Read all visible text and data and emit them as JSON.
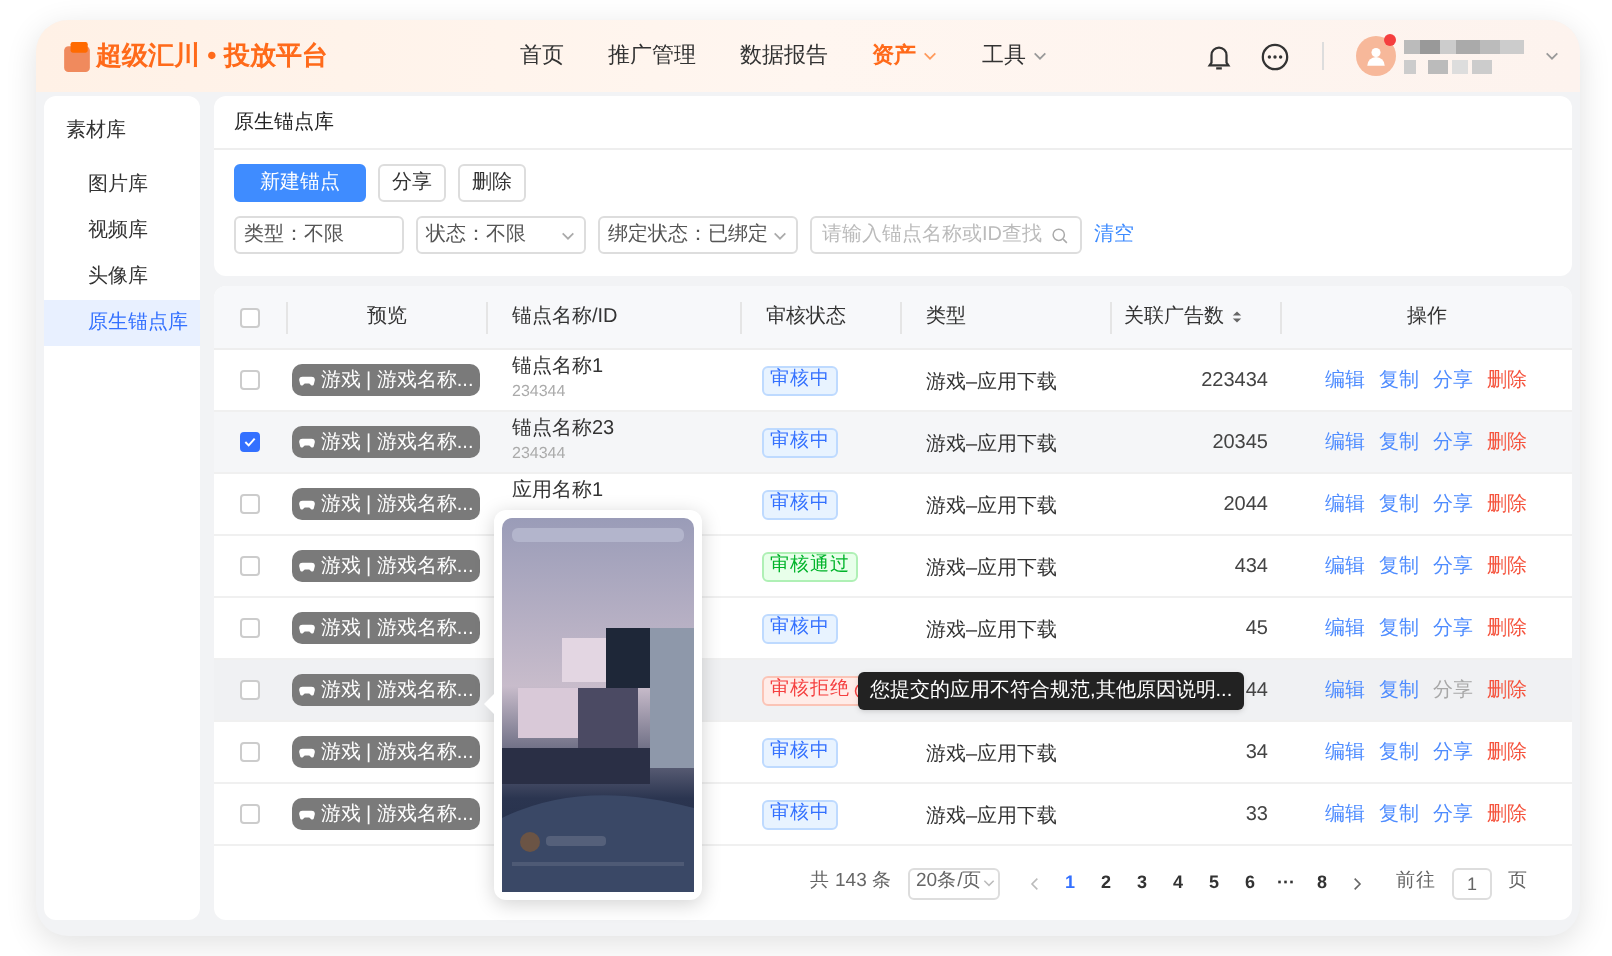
{
  "header": {
    "logo": "超级汇川 • 投放平台",
    "nav": [
      {
        "label": "首页",
        "selected": false,
        "dropdown": false
      },
      {
        "label": "推广管理",
        "selected": false,
        "dropdown": false
      },
      {
        "label": "数据报告",
        "selected": false,
        "dropdown": false
      },
      {
        "label": "资产",
        "selected": true,
        "dropdown": true
      },
      {
        "label": "工具",
        "selected": false,
        "dropdown": true
      }
    ],
    "notification_dot": true
  },
  "sidebar": {
    "title": "素材库",
    "items": [
      {
        "label": "图片库",
        "selected": false
      },
      {
        "label": "视频库",
        "selected": false
      },
      {
        "label": "头像库",
        "selected": false
      },
      {
        "label": "原生锚点库",
        "selected": true
      }
    ]
  },
  "page_title": "原生锚点库",
  "buttons": [
    {
      "label": "新建锚点",
      "kind": "primary"
    },
    {
      "label": "分享",
      "kind": "default"
    },
    {
      "label": "删除",
      "kind": "default"
    }
  ],
  "filters": [
    {
      "label": "类型：不限",
      "dropdown": false
    },
    {
      "label": "状态：不限",
      "dropdown": true
    },
    {
      "label": "绑定状态：已绑定",
      "dropdown": true
    }
  ],
  "search": {
    "placeholder": "请输入锚点名称或ID查找"
  },
  "clear_link": "清空",
  "table": {
    "all_selected": false,
    "columns": [
      {
        "label": "预览",
        "sortable": false
      },
      {
        "label": "锚点名称/ID",
        "sortable": false
      },
      {
        "label": "审核状态",
        "sortable": false
      },
      {
        "label": "类型",
        "sortable": false
      },
      {
        "label": "关联广告数",
        "sortable": true
      },
      {
        "label": "操作",
        "sortable": false
      }
    ],
    "rows": [
      {
        "selected": false,
        "hovered": false,
        "preview": "游戏 | 游戏名称...",
        "name": "锚点名称1",
        "id": "234344",
        "status": {
          "label": "审核中",
          "kind": "reviewing"
        },
        "type": "游戏–应用下载",
        "ad_count": "223434",
        "actions": [
          {
            "label": "编辑",
            "kind": "link",
            "disabled": false
          },
          {
            "label": "复制",
            "kind": "link",
            "disabled": false
          },
          {
            "label": "分享",
            "kind": "link",
            "disabled": false
          },
          {
            "label": "删除",
            "kind": "danger",
            "disabled": false
          }
        ]
      },
      {
        "selected": true,
        "hovered": false,
        "preview": "游戏 | 游戏名称...",
        "name": "锚点名称23",
        "id": "234344",
        "status": {
          "label": "审核中",
          "kind": "reviewing"
        },
        "type": "游戏–应用下载",
        "ad_count": "20345",
        "actions": [
          {
            "label": "编辑",
            "kind": "link",
            "disabled": false
          },
          {
            "label": "复制",
            "kind": "link",
            "disabled": false
          },
          {
            "label": "分享",
            "kind": "link",
            "disabled": false
          },
          {
            "label": "删除",
            "kind": "danger",
            "disabled": false
          }
        ]
      },
      {
        "selected": false,
        "hovered": false,
        "preview": "游戏 | 游戏名称...",
        "name": "应用名称1",
        "status": {
          "label": "审核中",
          "kind": "reviewing"
        },
        "type": "游戏–应用下载",
        "ad_count": "2044",
        "actions": [
          {
            "label": "编辑",
            "kind": "link",
            "disabled": false
          },
          {
            "label": "复制",
            "kind": "link",
            "disabled": false
          },
          {
            "label": "分享",
            "kind": "link",
            "disabled": false
          },
          {
            "label": "删除",
            "kind": "danger",
            "disabled": false
          }
        ]
      },
      {
        "selected": false,
        "hovered": false,
        "preview": "游戏 | 游戏名称...",
        "status": {
          "label": "审核通过",
          "kind": "approved"
        },
        "type": "游戏–应用下载",
        "ad_count": "434",
        "actions": [
          {
            "label": "编辑",
            "kind": "link",
            "disabled": false
          },
          {
            "label": "复制",
            "kind": "link",
            "disabled": false
          },
          {
            "label": "分享",
            "kind": "link",
            "disabled": false
          },
          {
            "label": "删除",
            "kind": "danger",
            "disabled": false
          }
        ]
      },
      {
        "selected": false,
        "hovered": false,
        "preview": "游戏 | 游戏名称...",
        "status": {
          "label": "审核中",
          "kind": "reviewing"
        },
        "type": "游戏–应用下载",
        "ad_count": "45",
        "actions": [
          {
            "label": "编辑",
            "kind": "link",
            "disabled": false
          },
          {
            "label": "复制",
            "kind": "link",
            "disabled": false
          },
          {
            "label": "分享",
            "kind": "link",
            "disabled": false
          },
          {
            "label": "删除",
            "kind": "danger",
            "disabled": false
          }
        ]
      },
      {
        "selected": false,
        "hovered": true,
        "preview": "游戏 | 游戏名称...",
        "status": {
          "label": "审核拒绝",
          "kind": "rejected"
        },
        "ad_count": "44",
        "tooltip": "您提交的应用不符合规范,其他原因说明...",
        "actions": [
          {
            "label": "编辑",
            "kind": "link",
            "disabled": false
          },
          {
            "label": "复制",
            "kind": "link",
            "disabled": false
          },
          {
            "label": "分享",
            "kind": "link",
            "disabled": true
          },
          {
            "label": "删除",
            "kind": "danger",
            "disabled": false
          }
        ]
      },
      {
        "selected": false,
        "hovered": false,
        "preview": "游戏 | 游戏名称...",
        "status": {
          "label": "审核中",
          "kind": "reviewing"
        },
        "type": "游戏–应用下载",
        "ad_count": "34",
        "actions": [
          {
            "label": "编辑",
            "kind": "link",
            "disabled": false
          },
          {
            "label": "复制",
            "kind": "link",
            "disabled": false
          },
          {
            "label": "分享",
            "kind": "link",
            "disabled": false
          },
          {
            "label": "删除",
            "kind": "danger",
            "disabled": false
          }
        ]
      },
      {
        "selected": false,
        "hovered": false,
        "preview": "游戏 | 游戏名称...",
        "status": {
          "label": "审核中",
          "kind": "reviewing"
        },
        "type": "游戏–应用下载",
        "ad_count": "33",
        "actions": [
          {
            "label": "编辑",
            "kind": "link",
            "disabled": false
          },
          {
            "label": "复制",
            "kind": "link",
            "disabled": false
          },
          {
            "label": "分享",
            "kind": "link",
            "disabled": false
          },
          {
            "label": "删除",
            "kind": "danger",
            "disabled": false
          }
        ]
      }
    ]
  },
  "pagination": {
    "total": "共 143 条",
    "page_size": "20条/页",
    "pages": [
      {
        "label": "1",
        "selected": true
      },
      {
        "label": "2",
        "selected": false
      },
      {
        "label": "3",
        "selected": false
      },
      {
        "label": "4",
        "selected": false
      },
      {
        "label": "5",
        "selected": false
      },
      {
        "label": "6",
        "selected": false
      },
      {
        "label": "···",
        "selected": false
      },
      {
        "label": "8",
        "selected": false
      }
    ],
    "goto_label": "前往",
    "goto_value": "1",
    "goto_suffix": "页"
  }
}
